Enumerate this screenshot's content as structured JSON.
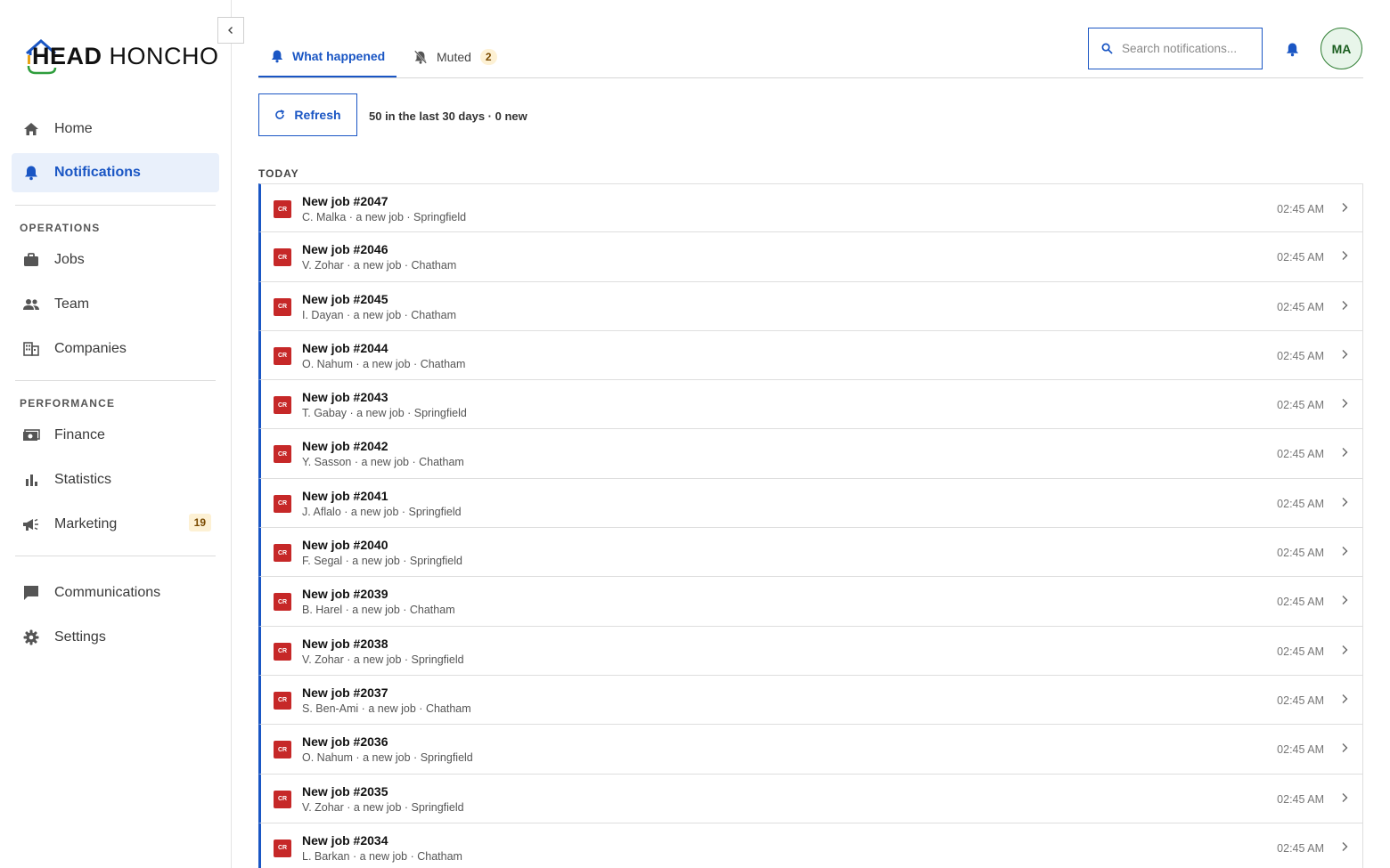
{
  "brand": {
    "logo_bold": "HEAD",
    "logo_regular": " HONCHO"
  },
  "sidebar": {
    "items_top": [
      {
        "label": "Home",
        "icon": "home-icon"
      },
      {
        "label": "Notifications",
        "icon": "bell-icon",
        "active": true
      }
    ],
    "sections": [
      {
        "label": "OPERATIONS",
        "items": [
          {
            "label": "Jobs",
            "icon": "briefcase-icon"
          },
          {
            "label": "Team",
            "icon": "people-icon"
          },
          {
            "label": "Companies",
            "icon": "building-icon"
          }
        ]
      },
      {
        "label": "PERFORMANCE",
        "items": [
          {
            "label": "Finance",
            "icon": "money-icon"
          },
          {
            "label": "Statistics",
            "icon": "bar-chart-icon"
          },
          {
            "label": "Marketing",
            "icon": "megaphone-icon",
            "badge": "19"
          }
        ]
      }
    ],
    "items_bottom": [
      {
        "label": "Communications",
        "icon": "chat-icon"
      },
      {
        "label": "Settings",
        "icon": "gear-icon"
      }
    ]
  },
  "tabs": {
    "what_happened": "What happened",
    "muted": "Muted",
    "muted_count": "2"
  },
  "search": {
    "placeholder": "Search notifications..."
  },
  "user": {
    "initials": "MA"
  },
  "toolbar": {
    "refresh_label": "Refresh",
    "summary": "50 in the last 30 days · 0 new"
  },
  "group_label": "TODAY",
  "badge_text": "CR",
  "notifications": [
    {
      "title": "New job #2047",
      "subtitle": "C. Malka · a new job · Springfield",
      "time": "02:45 AM"
    },
    {
      "title": "New job #2046",
      "subtitle": "V. Zohar · a new job · Chatham",
      "time": "02:45 AM"
    },
    {
      "title": "New job #2045",
      "subtitle": "I. Dayan · a new job · Chatham",
      "time": "02:45 AM"
    },
    {
      "title": "New job #2044",
      "subtitle": "O. Nahum · a new job · Chatham",
      "time": "02:45 AM"
    },
    {
      "title": "New job #2043",
      "subtitle": "T. Gabay · a new job · Springfield",
      "time": "02:45 AM"
    },
    {
      "title": "New job #2042",
      "subtitle": "Y. Sasson · a new job · Chatham",
      "time": "02:45 AM"
    },
    {
      "title": "New job #2041",
      "subtitle": "J. Aflalo · a new job · Springfield",
      "time": "02:45 AM"
    },
    {
      "title": "New job #2040",
      "subtitle": "F. Segal · a new job · Springfield",
      "time": "02:45 AM"
    },
    {
      "title": "New job #2039",
      "subtitle": "B. Harel · a new job · Chatham",
      "time": "02:45 AM"
    },
    {
      "title": "New job #2038",
      "subtitle": "V. Zohar · a new job · Springfield",
      "time": "02:45 AM"
    },
    {
      "title": "New job #2037",
      "subtitle": "S. Ben-Ami · a new job · Chatham",
      "time": "02:45 AM"
    },
    {
      "title": "New job #2036",
      "subtitle": "O. Nahum · a new job · Springfield",
      "time": "02:45 AM"
    },
    {
      "title": "New job #2035",
      "subtitle": "V. Zohar · a new job · Springfield",
      "time": "02:45 AM"
    },
    {
      "title": "New job #2034",
      "subtitle": "L. Barkan · a new job · Chatham",
      "time": "02:45 AM"
    }
  ],
  "colors": {
    "accent": "#1a56c4",
    "badge_bg": "#c62828",
    "avatar_border": "#2e7d32"
  }
}
